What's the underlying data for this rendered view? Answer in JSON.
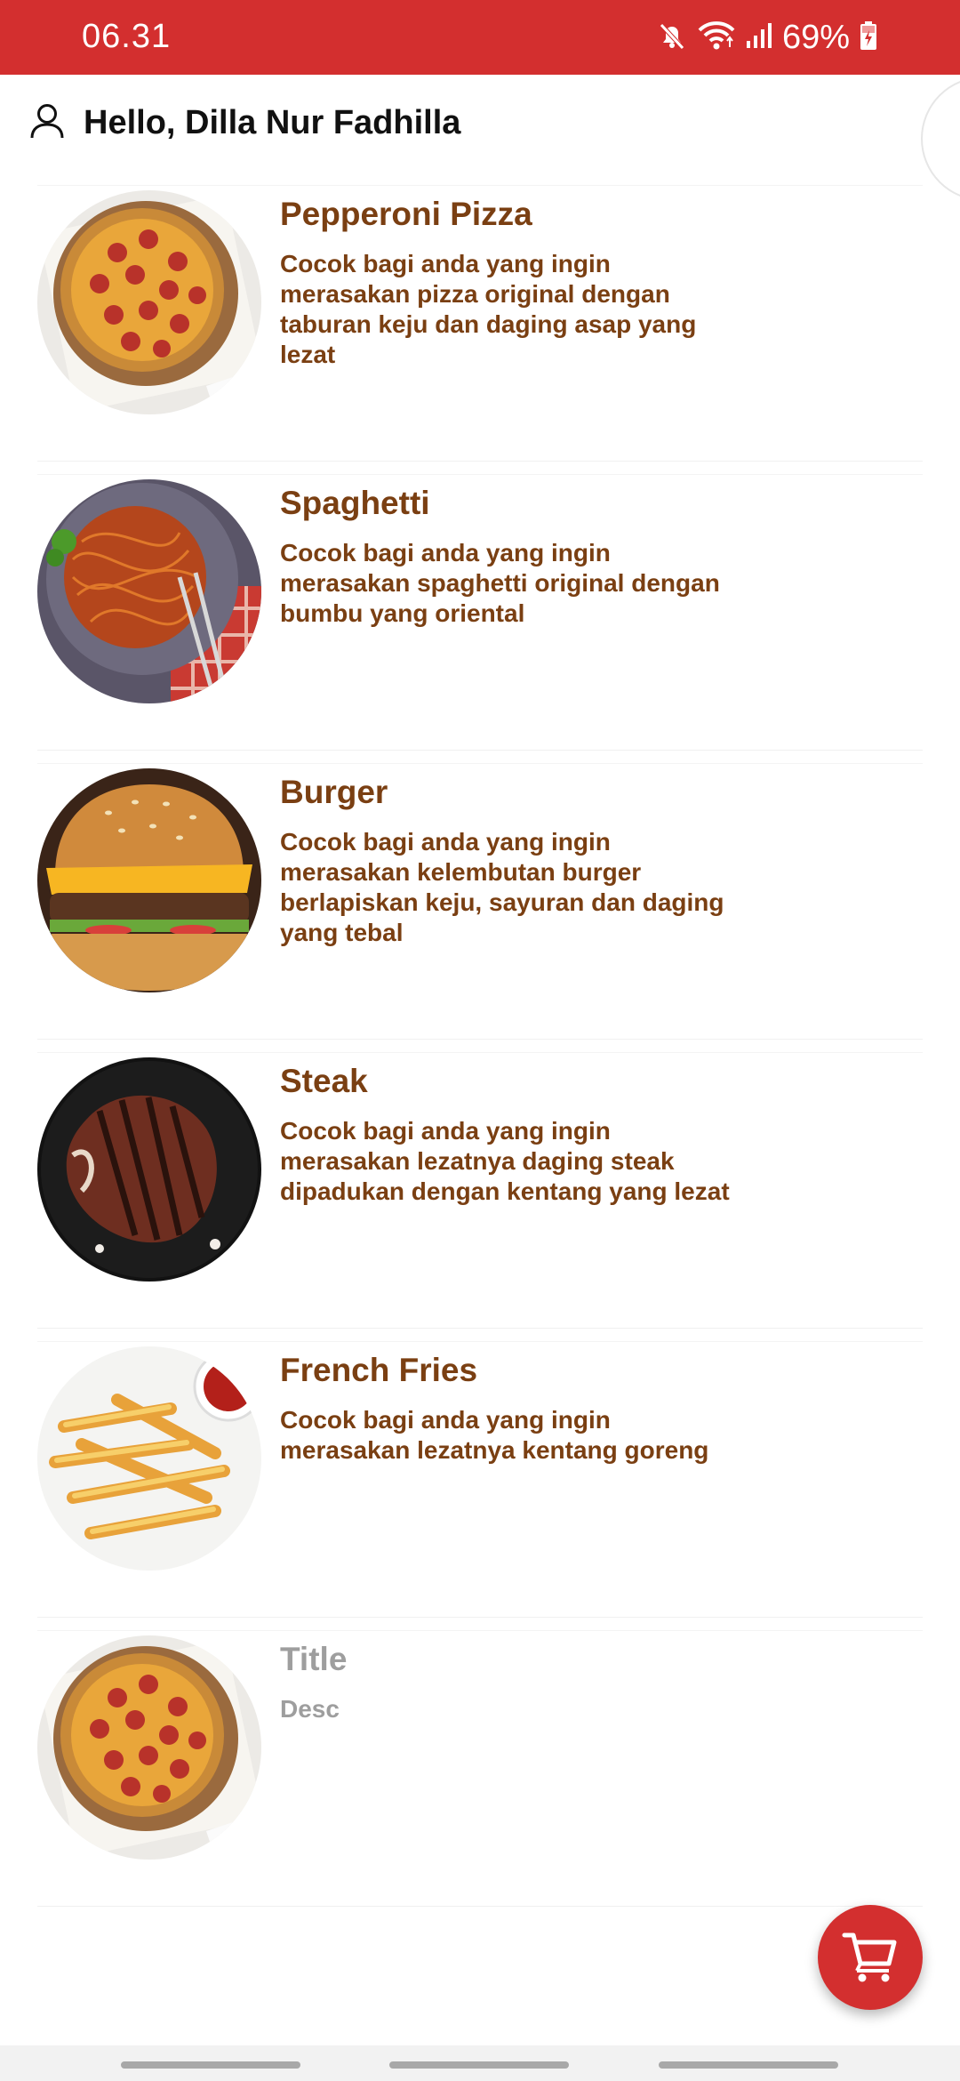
{
  "status_bar": {
    "time": "06.31",
    "battery_percent": "69%",
    "icons": [
      "mute-icon",
      "wifi-icon",
      "signal-icon",
      "battery-charging-icon"
    ],
    "background_color": "#d32f2f"
  },
  "header": {
    "greeting": "Hello, Dilla Nur Fadhilla",
    "icon": "user-icon"
  },
  "foods": [
    {
      "title": "Pepperoni Pizza",
      "desc": "Cocok bagi anda yang ingin merasakan pizza original dengan taburan keju dan daging asap yang lezat",
      "image": "pizza"
    },
    {
      "title": "Spaghetti",
      "desc": "Cocok bagi anda yang ingin merasakan spaghetti original dengan bumbu yang oriental",
      "image": "spaghetti"
    },
    {
      "title": "Burger",
      "desc": "Cocok bagi anda yang ingin merasakan kelembutan burger berlapiskan keju, sayuran dan daging yang tebal",
      "image": "burger"
    },
    {
      "title": "Steak",
      "desc": "Cocok bagi anda yang ingin merasakan lezatnya daging steak dipadukan dengan kentang yang lezat",
      "image": "steak"
    },
    {
      "title": "French Fries",
      "desc": "Cocok bagi anda yang ingin merasakan lezatnya kentang goreng",
      "image": "fries"
    },
    {
      "title": "Title",
      "desc": "Desc",
      "image": "pizza"
    }
  ],
  "cart_button": {
    "icon": "cart-icon",
    "color": "#d32f2f"
  },
  "colors": {
    "accent": "#d32f2f",
    "title_text": "#7a3f12",
    "placeholder_text": "#9e9e9e"
  }
}
